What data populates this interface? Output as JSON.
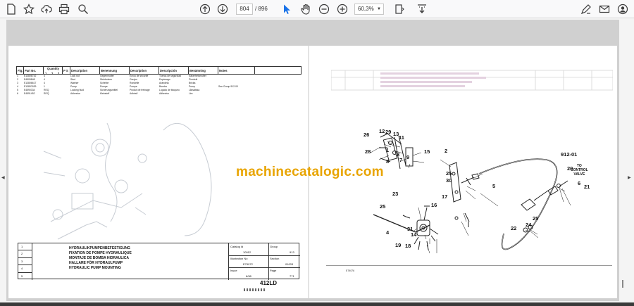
{
  "toolbar": {
    "current_page": "804",
    "page_total": "/ 896",
    "zoom": "60,3%"
  },
  "left_page": {
    "table_headers": [
      "Fig. No.",
      "Part No.",
      "Quantity",
      "",
      "",
      "P S",
      "Description",
      "Benennung",
      "Description",
      "Descripción",
      "Benämning",
      "Notes"
    ],
    "quantity_subheaders": [
      "1",
      "2",
      "3"
    ],
    "rows": [
      {
        "fig": "1",
        "part": "E13806742",
        "qty": "4",
        "ps": "",
        "d1": "Lock nut",
        "d2": "Gegenmutter",
        "d3": "Écrou de sécurité",
        "d4": "Tuerca de seguridad",
        "d5": "Säkerhetsmutter",
        "note": ""
      },
      {
        "fig": "2",
        "part": "E4509848",
        "qty": "4",
        "ps": "",
        "d1": "Stud",
        "d2": "Stehbolzen",
        "d3": "Goujon",
        "d4": "Espárrago",
        "d5": "Pinnbult",
        "note": ""
      },
      {
        "fig": "3",
        "part": "E13806617",
        "qty": "4",
        "ps": "",
        "d1": "Washer",
        "d2": "Scheibe",
        "d3": "Rondelle",
        "d4": "Arandela",
        "d5": "Bricka",
        "note": ""
      },
      {
        "fig": "4",
        "part": "E13897639",
        "qty": "1",
        "ps": "",
        "d1": "Pump",
        "d2": "Pumpe",
        "d3": "Pompe",
        "d4": "Bomba",
        "d5": "Pump",
        "note": "See Group 912-00"
      },
      {
        "fig": "5",
        "part": "E4590334",
        "qty": "REQ",
        "ps": "",
        "d1": "Locking fluid",
        "d2": "Sicherungsmittel",
        "d3": "Produit de freinage",
        "d4": "Líquido de bloqueo",
        "d5": "Låsvätska",
        "note": ""
      },
      {
        "fig": "6",
        "part": "E4591452",
        "qty": "REQ",
        "ps": "",
        "d1": "Adhesive",
        "d2": "Klebstoff",
        "d3": "Adhésif",
        "d4": "Adhesivo",
        "d5": "Lim",
        "note": ""
      }
    ],
    "title_lines": [
      "1",
      "2",
      "3",
      "4",
      "5"
    ],
    "titles": [
      "HYDRAULIKPUMPENBEFESTIGUNG",
      "FIXATION DE POMPE HYDRAULIQUE",
      "MONTAJE DE BOMBA HIDRAULICA",
      "HALLARE FÖR HYDRAULPUMP",
      "HYDRAULIC PUMP MOUNTING"
    ],
    "catalog_id_label": "Catalog Id",
    "catalog_id": "10012",
    "group_label": "Group",
    "group": "913",
    "illustration_label": "Illustration No",
    "illustration": "E79072",
    "section_label": "Section",
    "section": "01003",
    "issue_label": "Issue",
    "issue": "6/98",
    "page_label": "Page",
    "page": "771",
    "model": "412LD"
  },
  "watermark": "machinecatalogic.com",
  "right_page": {
    "callouts": [
      "26",
      "12",
      "29",
      "13",
      "11",
      "28",
      "1",
      "3",
      "9",
      "7",
      "8",
      "15",
      "2",
      "25",
      "30",
      "5",
      "912-01",
      "20",
      "6",
      "21",
      "23",
      "17",
      "25",
      "16",
      "4",
      "31",
      "14",
      "19",
      "18",
      "22",
      "24",
      "25"
    ],
    "to_valve_text": [
      "TO",
      "CONTROL",
      "VALVE"
    ],
    "footer_ref": "E79076"
  }
}
